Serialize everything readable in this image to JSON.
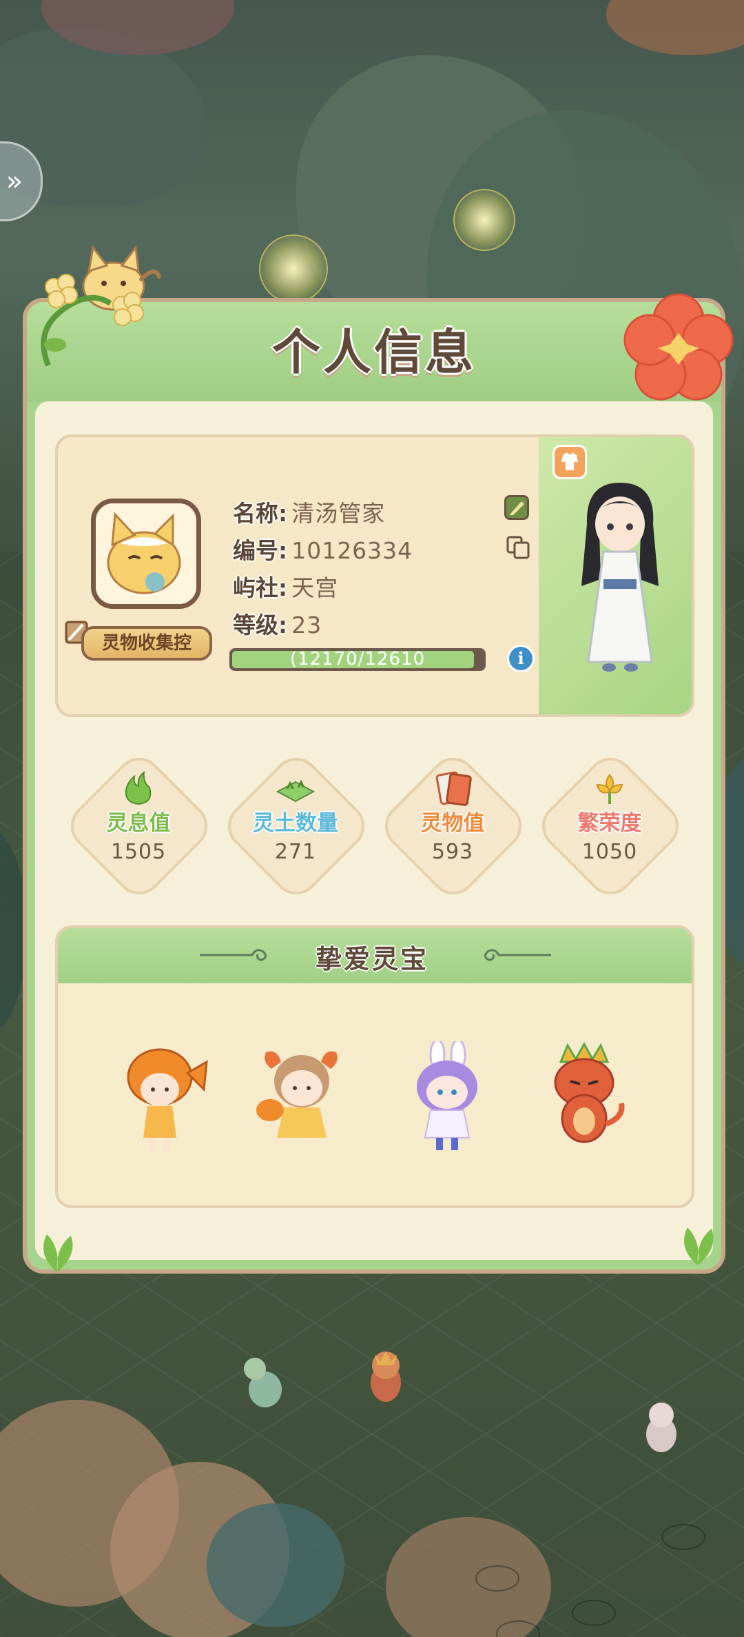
{
  "panel": {
    "title": "个人信息"
  },
  "profile": {
    "badge": "灵物收集控",
    "name_label": "名称:",
    "name_value": "清汤管家",
    "id_label": "编号:",
    "id_value": "10126334",
    "society_label": "屿社:",
    "society_value": "天宫",
    "level_label": "等级:",
    "level_value": "23",
    "xp_text": "(12170/12610",
    "xp_progress": 0.965
  },
  "stats": [
    {
      "label": "灵息值",
      "value": "1505",
      "color": "#7dbb4a",
      "icon": "green-flame-icon"
    },
    {
      "label": "灵土数量",
      "value": "271",
      "color": "#5cb9d8",
      "icon": "soil-patch-icon"
    },
    {
      "label": "灵物值",
      "value": "593",
      "color": "#ef8a3a",
      "icon": "book-card-icon"
    },
    {
      "label": "繁荣度",
      "value": "1050",
      "color": "#ec7a6e",
      "icon": "yellow-flower-icon"
    }
  ],
  "favorites": {
    "title": "挚爱灵宝",
    "pets": [
      "goldfish-girl-pet-icon",
      "ram-horn-girl-pet-icon",
      "bunny-ear-girl-pet-icon",
      "red-dragon-pet-icon"
    ]
  },
  "colors": {
    "panel_green": "#a6d48d",
    "cream": "#f7f0d9",
    "brown_text": "#5f4a3a",
    "info_blue": "#3f8fc6"
  }
}
